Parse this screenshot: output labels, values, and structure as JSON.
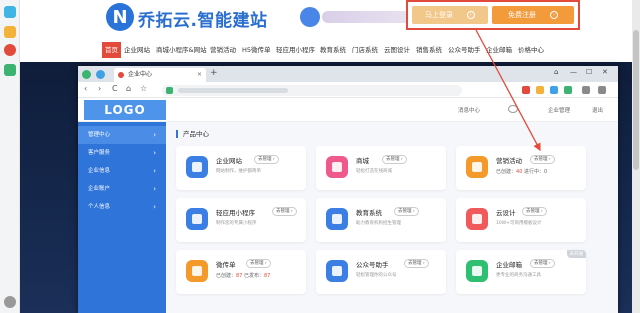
{
  "site": {
    "logo_letter": "N",
    "title": "乔拓云.智能建站",
    "login_label": "马上登录",
    "register_label": "免费注册",
    "arrow_glyph": "›"
  },
  "site_nav": [
    "首页",
    "企业网站",
    "商城小程序&网站",
    "营销活动",
    "H5微传单",
    "轻应用小程序",
    "教育系统",
    "门店系统",
    "云图设计",
    "销售系统",
    "公众号助手",
    "企业邮箱",
    "价格中心"
  ],
  "browser": {
    "tab_title": "企业中心",
    "tab_close": "×",
    "new_tab": "+",
    "controls": [
      "⌂",
      "—",
      "☐",
      "✕"
    ],
    "nav_buttons": [
      "‹",
      "›",
      "C",
      "⌂",
      "☆"
    ]
  },
  "admin": {
    "logo": "LOGO",
    "header_right_1": "消息中心",
    "header_right_2": "企业管理",
    "header_right_3": "退出",
    "menu": [
      {
        "label": "管理中心",
        "chev": "›"
      },
      {
        "label": "客户服务",
        "chev": "›"
      },
      {
        "label": "企业信息",
        "chev": "›"
      },
      {
        "label": "企业账户",
        "chev": "›"
      },
      {
        "label": "个人信息",
        "chev": "›"
      }
    ],
    "section_title": "产品中心",
    "manage_label": "去管理 ›"
  },
  "cards": [
    {
      "title": "企业网站",
      "desc": "网站制作，维护都简单",
      "color": "#3b7fe5"
    },
    {
      "title": "商城",
      "desc": "轻松打造在线商城",
      "color": "#f05a8a"
    },
    {
      "title": "营销活动",
      "stat_a_label": "已创建：",
      "stat_a": "40",
      "stat_b_label": "进行中：",
      "stat_b": "0",
      "color": "#f39a2b"
    },
    {
      "title": "轻应用小程序",
      "desc": "制作您的专属小程序",
      "color": "#3b7fe5"
    },
    {
      "title": "教育系统",
      "desc": "助力教育机构招生管理",
      "color": "#3b7fe5"
    },
    {
      "title": "云设计",
      "desc": "10W+可商用模板设计",
      "color": "#f05a5a"
    },
    {
      "title": "微传单",
      "stat_a_label": "已创建：",
      "stat_a": "87",
      "stat_b_label": "已发布：",
      "stat_b": "87",
      "color": "#f39a2b"
    },
    {
      "title": "公众号助手",
      "desc": "轻松管理你的公众号",
      "color": "#3b7fe5"
    },
    {
      "title": "企业邮箱",
      "desc": "更专业的商务沟通工具",
      "color": "#2fbf71",
      "tag": "未开通"
    }
  ],
  "colors": {
    "accent": "#2f74d8",
    "highlight": "#e24a3b",
    "orange": "#f39a3b"
  }
}
